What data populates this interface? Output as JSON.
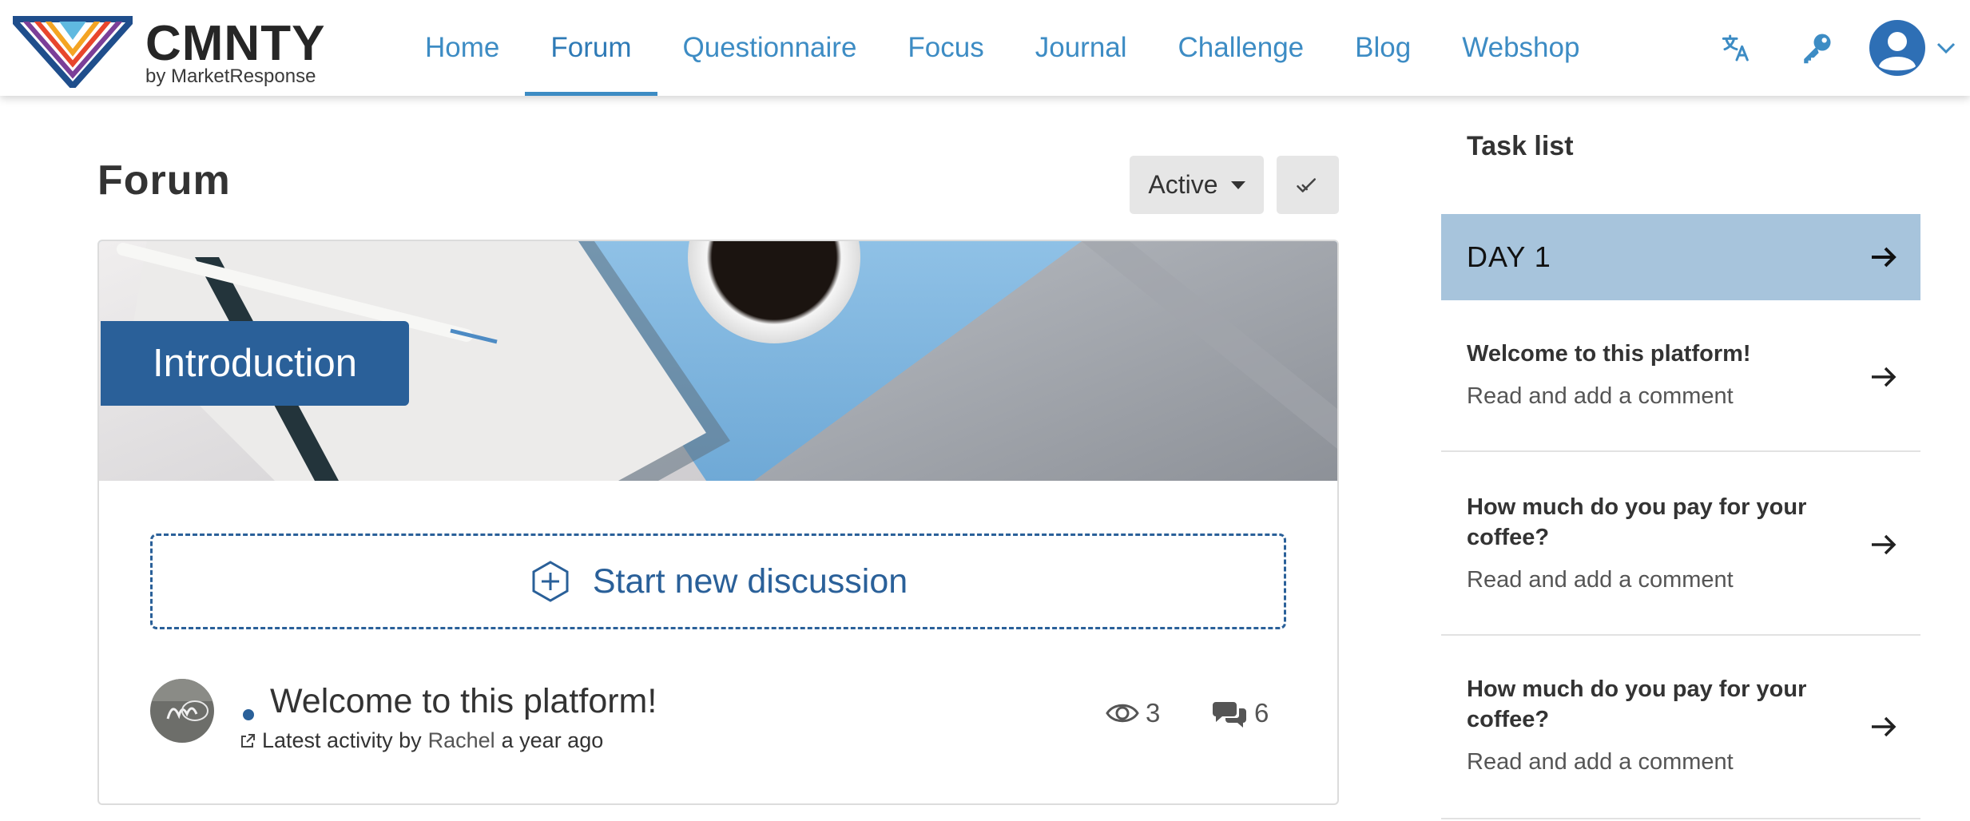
{
  "brand": {
    "name": "CMNTY",
    "tagline": "by MarketResponse"
  },
  "nav": {
    "items": [
      {
        "label": "Home"
      },
      {
        "label": "Forum"
      },
      {
        "label": "Questionnaire"
      },
      {
        "label": "Focus"
      },
      {
        "label": "Journal"
      },
      {
        "label": "Challenge"
      },
      {
        "label": "Blog"
      },
      {
        "label": "Webshop"
      }
    ],
    "active": "Forum",
    "icons": [
      "translate-icon",
      "key-icon",
      "user-avatar-icon",
      "chevron-down-icon"
    ]
  },
  "main": {
    "title": "Forum",
    "filter": {
      "selected": "Active"
    },
    "banner": {
      "label": "Introduction"
    },
    "start_discussion": "Start new discussion",
    "discussion": {
      "title": "Welcome to this platform!",
      "meta_prefix": "Latest activity by",
      "author": "Rachel",
      "time": "a year ago",
      "views": "3",
      "comments": "6",
      "unread": true
    }
  },
  "tasks": {
    "title": "Task list",
    "day": "DAY 1",
    "items": [
      {
        "name": "Welcome to this platform!",
        "action": "Read and add a comment"
      },
      {
        "name": "How much do you pay for your coffee?",
        "action": "Read and add a comment"
      },
      {
        "name": "How much do you pay for your coffee?",
        "action": "Read and add a comment"
      }
    ]
  },
  "colors": {
    "link": "#3d8cc4",
    "primary": "#2a6099",
    "day_bar": "#a7c4dc",
    "button_bg": "#e6e6e6"
  }
}
